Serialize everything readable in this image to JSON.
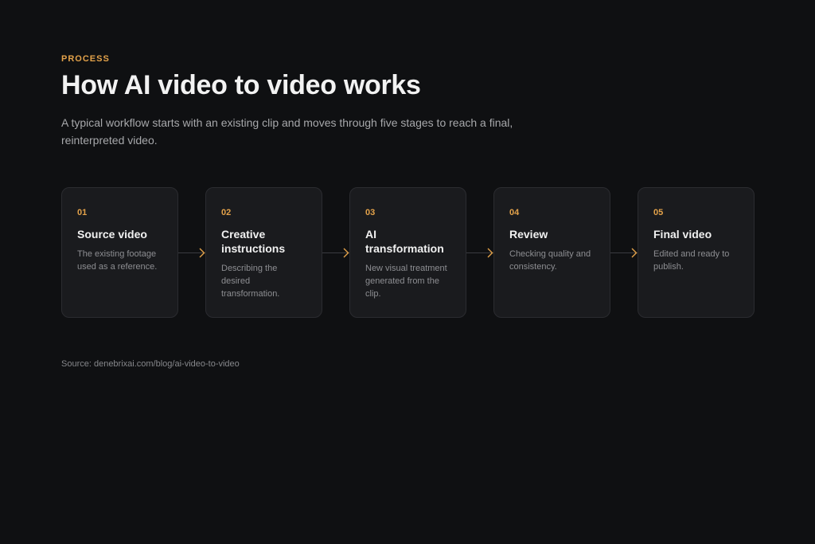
{
  "eyebrow": "PROCESS",
  "title": "How AI video to video works",
  "subtitle": "A typical workflow starts with an existing clip and moves through five stages to reach a final, reinterpreted video.",
  "steps": [
    {
      "num": "01",
      "title": "Source video",
      "desc": "The existing footage used as a reference."
    },
    {
      "num": "02",
      "title": "Creative instructions",
      "desc": "Describing the desired transformation."
    },
    {
      "num": "03",
      "title": "AI transformation",
      "desc": "New visual treatment generated from the clip."
    },
    {
      "num": "04",
      "title": "Review",
      "desc": "Checking quality and consistency."
    },
    {
      "num": "05",
      "title": "Final video",
      "desc": "Edited and ready to publish."
    }
  ],
  "source": "Source: denebrixai.com/blog/ai-video-to-video",
  "colors": {
    "accent": "#e3a24a",
    "background": "#0f1012",
    "card": "#1a1b1e"
  },
  "icons": {
    "connector": "chevron-right-icon"
  }
}
